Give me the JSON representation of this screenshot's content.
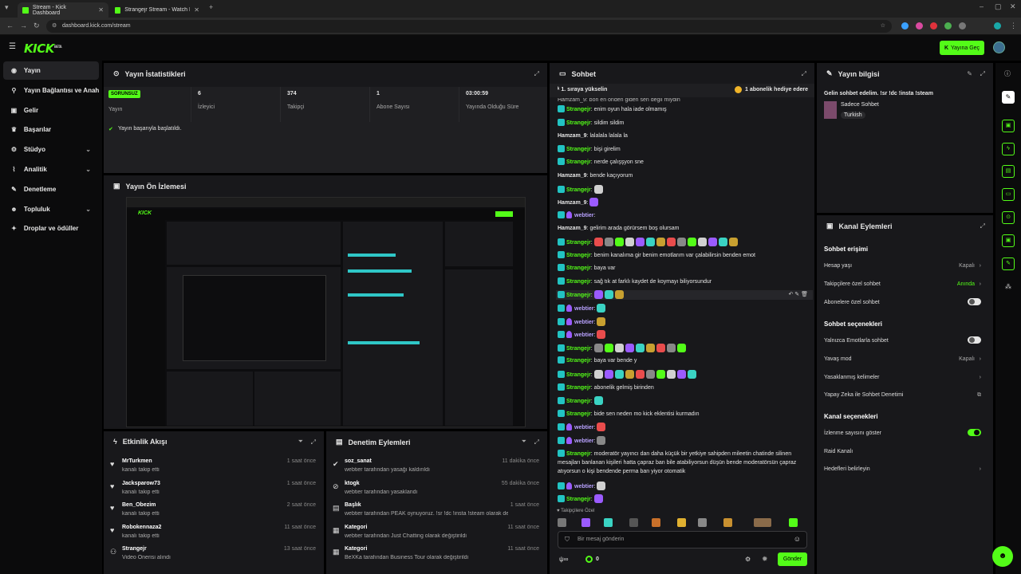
{
  "browser": {
    "tabs": [
      {
        "title": "Stream - Kick Dashboard",
        "active": true
      },
      {
        "title": "Strangejr Stream - Watch Live o",
        "active": false
      }
    ],
    "url": "dashboard.kick.com/stream"
  },
  "header": {
    "logo": "KICK",
    "logo_beta": "BETA",
    "go_live": "Yayına Geç"
  },
  "sidebar": {
    "items": [
      {
        "label": "Yayın",
        "icon": "broadcast-icon",
        "glyph": "◉",
        "active": true,
        "chev": ""
      },
      {
        "label": "Yayın Bağlantısı ve Anahtarı",
        "icon": "key-icon",
        "glyph": "⚲",
        "active": false,
        "chev": ""
      },
      {
        "label": "Gelir",
        "icon": "money-icon",
        "glyph": "▣",
        "active": false,
        "chev": ""
      },
      {
        "label": "Başarılar",
        "icon": "trophy-icon",
        "glyph": "♛",
        "active": false,
        "chev": ""
      },
      {
        "label": "Stüdyo",
        "icon": "studio-icon",
        "glyph": "⚙",
        "active": false,
        "chev": "⌄"
      },
      {
        "label": "Analitik",
        "icon": "analytics-icon",
        "glyph": "⌇",
        "active": false,
        "chev": "⌄"
      },
      {
        "label": "Denetleme",
        "icon": "wrench-icon",
        "glyph": "✎",
        "active": false,
        "chev": ""
      },
      {
        "label": "Topluluk",
        "icon": "community-icon",
        "glyph": "☻",
        "active": false,
        "chev": "⌄"
      },
      {
        "label": "Droplar ve ödüller",
        "icon": "gift-icon",
        "glyph": "✦",
        "active": false,
        "chev": ""
      }
    ]
  },
  "stats_panel": {
    "title": "Yayın İstatistikleri",
    "status_badge": "SORUNSUZ",
    "stats": [
      {
        "value": "",
        "label": "Yayın"
      },
      {
        "value": "6",
        "label": "İzleyici"
      },
      {
        "value": "374",
        "label": "Takipçi"
      },
      {
        "value": "1",
        "label": "Abone Sayısı"
      },
      {
        "value": "03:00:59",
        "label": "Yayında Olduğu Süre"
      }
    ],
    "success_message": "Yayın başarıyla başlatıldı."
  },
  "preview_panel": {
    "title": "Yayın Ön İzlemesi"
  },
  "activity_panel": {
    "title": "Etkinlik Akışı",
    "items": [
      {
        "name": "MrTurkmen",
        "sub": "kanalı takip etti",
        "time": "1 saat önce",
        "icon": "heart-icon",
        "glyph": "♥"
      },
      {
        "name": "Jacksparow73",
        "sub": "kanalı takip etti",
        "time": "1 saat önce",
        "icon": "heart-icon",
        "glyph": "♥"
      },
      {
        "name": "Ben_Obezim",
        "sub": "kanalı takip etti",
        "time": "2 saat önce",
        "icon": "heart-icon",
        "glyph": "♥"
      },
      {
        "name": "Robokennaza2",
        "sub": "kanalı takip etti",
        "time": "11 saat önce",
        "icon": "heart-icon",
        "glyph": "♥"
      },
      {
        "name": "Strangejr",
        "sub": "Video Önerisi alındı",
        "time": "13 saat önce",
        "icon": "users-icon",
        "glyph": "⚇"
      }
    ]
  },
  "mod_panel": {
    "title": "Denetim Eylemleri",
    "items": [
      {
        "name": "soz_sanat",
        "sub": "webtier tarafından yasağı kaldırıldı",
        "time": "11 dakika önce",
        "icon": "check-circle-icon",
        "glyph": "✔"
      },
      {
        "name": "ktogk",
        "sub": "webtier tarafından yasaklandı",
        "time": "55 dakika önce",
        "icon": "ban-icon",
        "glyph": "⊘"
      },
      {
        "name": "Başlık",
        "sub": "webtier tarafından PEAK oynuyoruz. !sr !dc !insta !steam olarak değiştirildi",
        "time": "1 saat önce",
        "icon": "title-icon",
        "glyph": "▤"
      },
      {
        "name": "Kategori",
        "sub": "webtier tarafından Just Chatting olarak değiştirildi",
        "time": "11 saat önce",
        "icon": "category-icon",
        "glyph": "▦"
      },
      {
        "name": "Kategori",
        "sub": "BeXKa tarafından Business Tour olarak değiştirildi",
        "time": "11 saat önce",
        "icon": "category-icon",
        "glyph": "▦"
      }
    ]
  },
  "chat": {
    "title": "Sohbet",
    "pinned_left": "1. sıraya yükselin",
    "pinned_right": "1 abonelik hediye edere",
    "top_partial": "Hamzam_9: bon en önden giden sen değil miydin",
    "messages": [
      {
        "user": "Strangejr",
        "text": "enim oyun hala iade olmamış",
        "kind": "green"
      },
      {
        "user": "Strangejr",
        "text": "sildim sildim",
        "kind": "green"
      },
      {
        "user": "Hamzam_9",
        "text": "lalalala lalala la",
        "kind": "plain"
      },
      {
        "user": "Strangejr",
        "text": "bişi girelim",
        "kind": "green"
      },
      {
        "user": "Strangejr",
        "text": "nerde çalışşyon sne",
        "kind": "green"
      },
      {
        "user": "Hamzam_9",
        "text": "bende kaçıyorum",
        "kind": "plain"
      },
      {
        "user": "Strangejr",
        "text": "",
        "kind": "green",
        "emotes": 1
      },
      {
        "user": "Hamzam_9",
        "text": "",
        "kind": "plain",
        "emotes": 1
      },
      {
        "user": "webtier",
        "text": "",
        "kind": "purple"
      },
      {
        "user": "Hamzam_9",
        "text": "gelirim arada görürsem boş olursam",
        "kind": "plain"
      },
      {
        "user": "Strangejr",
        "text": "",
        "kind": "green",
        "emotes": 14
      },
      {
        "user": "Strangejr",
        "text": "benim kanalıma gir benim emotlarım var çalabilirsin benden emot",
        "kind": "green"
      },
      {
        "user": "Strangejr",
        "text": "baya var",
        "kind": "green"
      },
      {
        "user": "Strangejr",
        "text": "sağ tık at farklı kaydet de koymayı biliyorsundur",
        "kind": "green"
      },
      {
        "user": "Strangejr",
        "text": "",
        "kind": "green",
        "emotes": 3,
        "highlight": true
      },
      {
        "user": "webtier",
        "text": "",
        "kind": "purple",
        "emotes": 1
      },
      {
        "user": "webtier",
        "text": "",
        "kind": "purple",
        "emotes": 1
      },
      {
        "user": "webtier",
        "text": "",
        "kind": "purple",
        "emotes": 1
      },
      {
        "user": "Strangejr",
        "text": "",
        "kind": "green",
        "emotes": 9
      },
      {
        "user": "Strangejr",
        "text": "baya var bende y",
        "kind": "green"
      },
      {
        "user": "Strangejr",
        "text": "",
        "kind": "green",
        "emotes": 10
      },
      {
        "user": "Strangejr",
        "text": "abonelik gelmiş birinden",
        "kind": "green"
      },
      {
        "user": "Strangejr",
        "text": "",
        "kind": "green",
        "emotes": 1
      },
      {
        "user": "Strangejr",
        "text": "bide sen neden mo kick eklentisi kurmadın",
        "kind": "green"
      },
      {
        "user": "webtier",
        "text": "",
        "kind": "purple",
        "emotes": 1
      },
      {
        "user": "webtier",
        "text": "",
        "kind": "purple",
        "emotes": 1
      },
      {
        "user": "Strangejr",
        "text": "moderatör yayıncı dan daha küçük bir yetkiye sahipden mileetin chatinde silinen mesajları banlanan kişileri hatta çapraz ban bile atabiliyorsun düşün bende moderatörsün çapraz atıyorsun o kişi bendende perma ban yiyor otomatik",
        "kind": "green",
        "multiline": true
      },
      {
        "user": "webtier",
        "text": "",
        "kind": "purple",
        "emotes": 1
      },
      {
        "user": "Strangejr",
        "text": "",
        "kind": "green",
        "emotes": 1
      }
    ],
    "emote_section": "Takipçilere Özel",
    "input_placeholder": "Bir mesaj gönderin",
    "points": "0",
    "send_label": "Gönder"
  },
  "stream_info": {
    "title": "Yayın bilgisi",
    "stream_title": "Gelin sohbet edelim. !sr !dc !insta !steam",
    "category": "Sadece Sohbet",
    "language": "Turkish"
  },
  "channel_actions": {
    "title": "Kanal Eylemleri",
    "section1": "Sohbet erişimi",
    "account_age": {
      "label": "Hesap yaşı",
      "value": "Kapalı"
    },
    "followers_only": {
      "label": "Takipçilere özel sohbet",
      "value": "Anında"
    },
    "subs_only": {
      "label": "Abonelere özel sohbet",
      "on": false
    },
    "section2": "Sohbet seçenekleri",
    "emote_only": {
      "label": "Yalnızca Emotlarla sohbet",
      "on": false
    },
    "slow_mode": {
      "label": "Yavaş mod",
      "value": "Kapalı"
    },
    "banned_words": {
      "label": "Yasaklanmış kelimeler"
    },
    "ai_moderation": {
      "label": "Yapay Zeka ile Sohbet Denetimi"
    },
    "section3": "Kanal seçenekleri",
    "show_viewers": {
      "label": "İzlenme sayısını göster",
      "on": true
    },
    "raid": {
      "label": "Raid Kanalı"
    },
    "goals": {
      "label": "Hedefleri belirleyin"
    }
  },
  "colors": {
    "accent": "#53fc18",
    "panel": "#18181b",
    "bg": "#000000"
  }
}
